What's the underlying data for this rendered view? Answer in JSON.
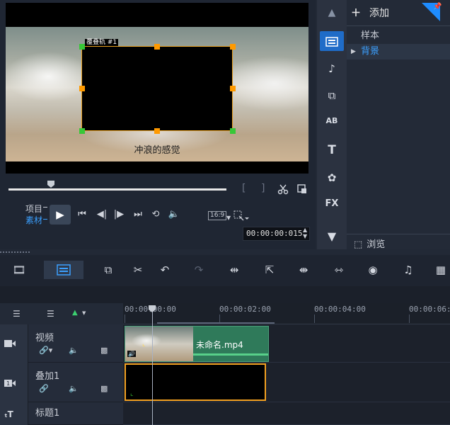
{
  "preview": {
    "overlay_tag": "覆叠轨 #1",
    "caption": "冲浪的感觉",
    "mode_project": "项目",
    "mode_clip": "素材",
    "aspect_label": "16:9",
    "timecode": "00:00:00:015",
    "bracket_in": "[",
    "bracket_out": "]"
  },
  "library": {
    "add_label": "添加",
    "items": [
      "样本",
      "背景"
    ],
    "selected_item": "背景",
    "browse_label": "浏览"
  },
  "toolstrip_icons": [
    "media-icon",
    "audio-icon",
    "transition-icon",
    "title-icon",
    "text-icon",
    "graphics-icon",
    "fx-icon",
    "scroll-down-icon"
  ],
  "toolstrip_fx_label": "FX",
  "toolstrip_ab_label": "AB",
  "toolstrip_t_label": "T",
  "timeline": {
    "ruler_labels": [
      "00:00:00:00",
      "00:00:02:00",
      "00:00:04:00",
      "00:00:06:0"
    ],
    "tracks": [
      {
        "name": "视频"
      },
      {
        "name": "叠加1"
      },
      {
        "name": "标题1"
      }
    ],
    "video_clip_label": "未命名.mp4"
  },
  "colors": {
    "accent_blue": "#3ba0ff",
    "handle_orange": "#ff9a00",
    "clip_green": "#2f7a5a",
    "overlay_border": "#f2a020"
  }
}
